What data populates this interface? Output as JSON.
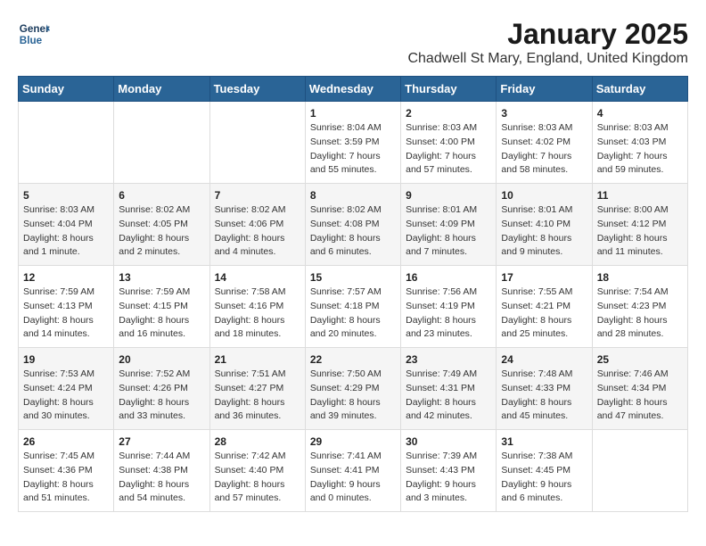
{
  "logo": {
    "line1": "General",
    "line2": "Blue"
  },
  "title": "January 2025",
  "subtitle": "Chadwell St Mary, England, United Kingdom",
  "weekdays": [
    "Sunday",
    "Monday",
    "Tuesday",
    "Wednesday",
    "Thursday",
    "Friday",
    "Saturday"
  ],
  "weeks": [
    [
      {
        "day": "",
        "info": ""
      },
      {
        "day": "",
        "info": ""
      },
      {
        "day": "",
        "info": ""
      },
      {
        "day": "1",
        "info": "Sunrise: 8:04 AM\nSunset: 3:59 PM\nDaylight: 7 hours and 55 minutes."
      },
      {
        "day": "2",
        "info": "Sunrise: 8:03 AM\nSunset: 4:00 PM\nDaylight: 7 hours and 57 minutes."
      },
      {
        "day": "3",
        "info": "Sunrise: 8:03 AM\nSunset: 4:02 PM\nDaylight: 7 hours and 58 minutes."
      },
      {
        "day": "4",
        "info": "Sunrise: 8:03 AM\nSunset: 4:03 PM\nDaylight: 7 hours and 59 minutes."
      }
    ],
    [
      {
        "day": "5",
        "info": "Sunrise: 8:03 AM\nSunset: 4:04 PM\nDaylight: 8 hours and 1 minute."
      },
      {
        "day": "6",
        "info": "Sunrise: 8:02 AM\nSunset: 4:05 PM\nDaylight: 8 hours and 2 minutes."
      },
      {
        "day": "7",
        "info": "Sunrise: 8:02 AM\nSunset: 4:06 PM\nDaylight: 8 hours and 4 minutes."
      },
      {
        "day": "8",
        "info": "Sunrise: 8:02 AM\nSunset: 4:08 PM\nDaylight: 8 hours and 6 minutes."
      },
      {
        "day": "9",
        "info": "Sunrise: 8:01 AM\nSunset: 4:09 PM\nDaylight: 8 hours and 7 minutes."
      },
      {
        "day": "10",
        "info": "Sunrise: 8:01 AM\nSunset: 4:10 PM\nDaylight: 8 hours and 9 minutes."
      },
      {
        "day": "11",
        "info": "Sunrise: 8:00 AM\nSunset: 4:12 PM\nDaylight: 8 hours and 11 minutes."
      }
    ],
    [
      {
        "day": "12",
        "info": "Sunrise: 7:59 AM\nSunset: 4:13 PM\nDaylight: 8 hours and 14 minutes."
      },
      {
        "day": "13",
        "info": "Sunrise: 7:59 AM\nSunset: 4:15 PM\nDaylight: 8 hours and 16 minutes."
      },
      {
        "day": "14",
        "info": "Sunrise: 7:58 AM\nSunset: 4:16 PM\nDaylight: 8 hours and 18 minutes."
      },
      {
        "day": "15",
        "info": "Sunrise: 7:57 AM\nSunset: 4:18 PM\nDaylight: 8 hours and 20 minutes."
      },
      {
        "day": "16",
        "info": "Sunrise: 7:56 AM\nSunset: 4:19 PM\nDaylight: 8 hours and 23 minutes."
      },
      {
        "day": "17",
        "info": "Sunrise: 7:55 AM\nSunset: 4:21 PM\nDaylight: 8 hours and 25 minutes."
      },
      {
        "day": "18",
        "info": "Sunrise: 7:54 AM\nSunset: 4:23 PM\nDaylight: 8 hours and 28 minutes."
      }
    ],
    [
      {
        "day": "19",
        "info": "Sunrise: 7:53 AM\nSunset: 4:24 PM\nDaylight: 8 hours and 30 minutes."
      },
      {
        "day": "20",
        "info": "Sunrise: 7:52 AM\nSunset: 4:26 PM\nDaylight: 8 hours and 33 minutes."
      },
      {
        "day": "21",
        "info": "Sunrise: 7:51 AM\nSunset: 4:27 PM\nDaylight: 8 hours and 36 minutes."
      },
      {
        "day": "22",
        "info": "Sunrise: 7:50 AM\nSunset: 4:29 PM\nDaylight: 8 hours and 39 minutes."
      },
      {
        "day": "23",
        "info": "Sunrise: 7:49 AM\nSunset: 4:31 PM\nDaylight: 8 hours and 42 minutes."
      },
      {
        "day": "24",
        "info": "Sunrise: 7:48 AM\nSunset: 4:33 PM\nDaylight: 8 hours and 45 minutes."
      },
      {
        "day": "25",
        "info": "Sunrise: 7:46 AM\nSunset: 4:34 PM\nDaylight: 8 hours and 47 minutes."
      }
    ],
    [
      {
        "day": "26",
        "info": "Sunrise: 7:45 AM\nSunset: 4:36 PM\nDaylight: 8 hours and 51 minutes."
      },
      {
        "day": "27",
        "info": "Sunrise: 7:44 AM\nSunset: 4:38 PM\nDaylight: 8 hours and 54 minutes."
      },
      {
        "day": "28",
        "info": "Sunrise: 7:42 AM\nSunset: 4:40 PM\nDaylight: 8 hours and 57 minutes."
      },
      {
        "day": "29",
        "info": "Sunrise: 7:41 AM\nSunset: 4:41 PM\nDaylight: 9 hours and 0 minutes."
      },
      {
        "day": "30",
        "info": "Sunrise: 7:39 AM\nSunset: 4:43 PM\nDaylight: 9 hours and 3 minutes."
      },
      {
        "day": "31",
        "info": "Sunrise: 7:38 AM\nSunset: 4:45 PM\nDaylight: 9 hours and 6 minutes."
      },
      {
        "day": "",
        "info": ""
      }
    ]
  ]
}
